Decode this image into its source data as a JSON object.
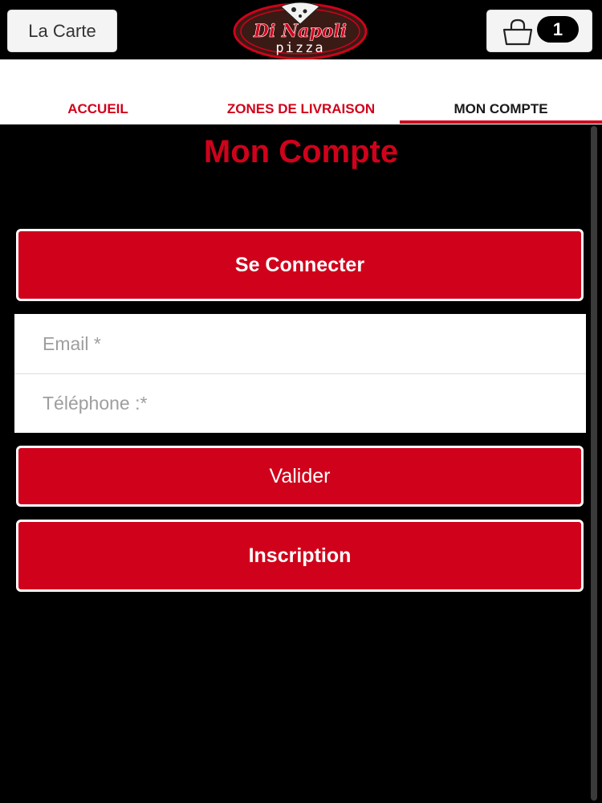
{
  "header": {
    "menu_label": "La Carte",
    "logo_title": "Di Napoli",
    "logo_subtitle": "pizza",
    "cart_count": "1",
    "colors": {
      "accent": "#d0021b",
      "logo_dark": "#3a1a14"
    }
  },
  "tabs": [
    {
      "label": "ACCUEIL",
      "active": false
    },
    {
      "label": "ZONES DE LIVRAISON",
      "active": false
    },
    {
      "label": "MON COMPTE",
      "active": true
    }
  ],
  "main": {
    "title": "Mon Compte",
    "connect_label": "Se Connecter",
    "email_placeholder": "Email *",
    "phone_placeholder": "Téléphone :*",
    "submit_label": "Valider",
    "signup_label": "Inscription"
  },
  "icons": [
    "shopping-bag-icon",
    "pizza-logo-icon"
  ]
}
